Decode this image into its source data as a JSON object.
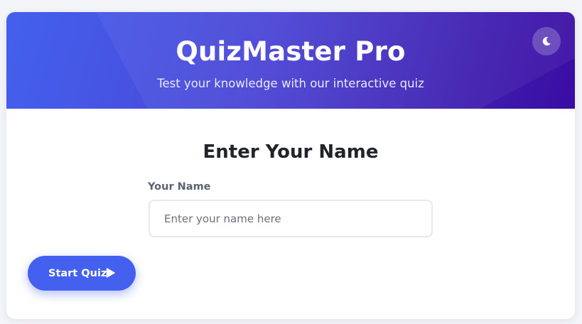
{
  "header": {
    "title": "QuizMaster Pro",
    "subtitle": "Test your knowledge with our interactive quiz",
    "theme_toggle_icon": "moon-icon"
  },
  "name_form": {
    "heading": "Enter Your Name",
    "label": "Your Name",
    "input_value": "",
    "placeholder": "Enter your name here"
  },
  "actions": {
    "start_label": "Start Quiz",
    "start_icon": "play-icon"
  },
  "colors": {
    "accent": "#4361ee",
    "header_gradient_start": "#4361ee",
    "header_gradient_end": "#3a0ca3",
    "page_background": "#f4f5f8",
    "card_background": "#ffffff"
  }
}
